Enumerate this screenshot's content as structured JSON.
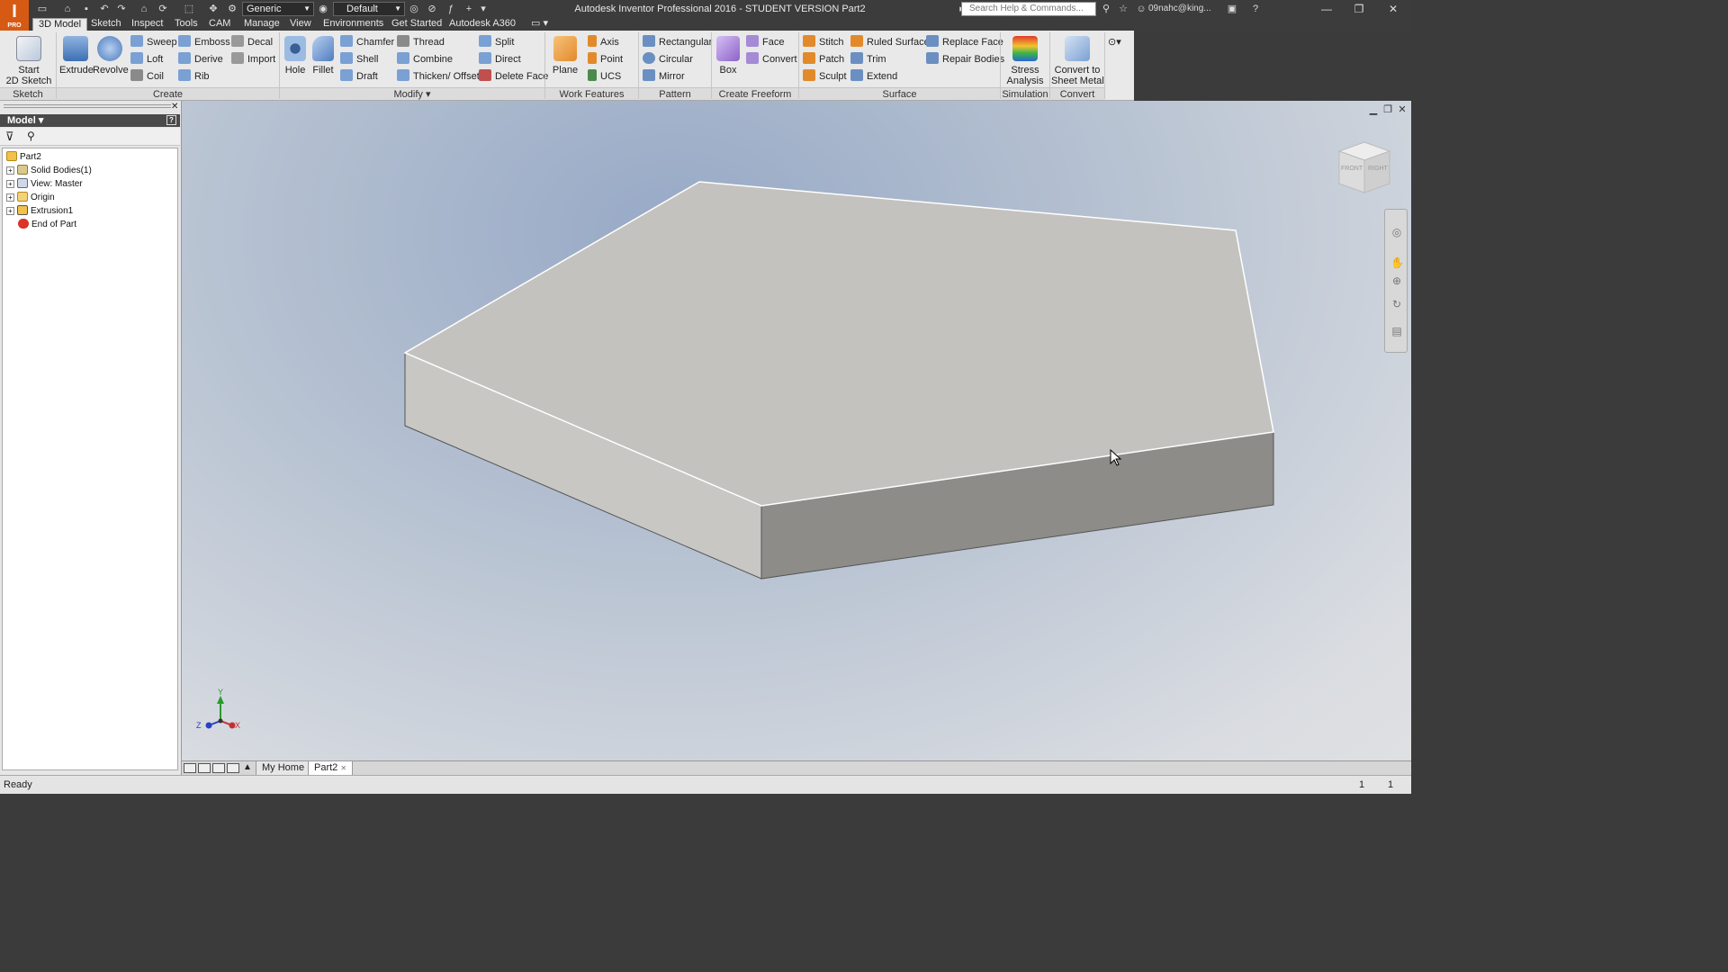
{
  "window": {
    "title": "Autodesk Inventor Professional 2016 - STUDENT VERSION   Part2",
    "logo_letter": "I",
    "logo_sub": "PRO"
  },
  "quick_access": {
    "material": "Generic",
    "appearance": "Default",
    "icons": [
      "new-icon",
      "open-icon",
      "save-icon",
      "undo-icon",
      "redo-icon",
      "home-icon",
      "select-icon",
      "measure-icon",
      "function-icon"
    ]
  },
  "search": {
    "placeholder": "Search Help & Commands..."
  },
  "user": {
    "name": "09nahc@king..."
  },
  "ribbon_tabs": [
    "3D Model",
    "Sketch",
    "Inspect",
    "Tools",
    "CAM",
    "Manage",
    "View",
    "Environments",
    "Get Started",
    "Autodesk A360"
  ],
  "panels": {
    "sketch": {
      "title": "Sketch",
      "start_sketch": "Start\n2D Sketch"
    },
    "create": {
      "title": "Create",
      "extrude": "Extrude",
      "revolve": "Revolve",
      "sweep": "Sweep",
      "loft": "Loft",
      "coil": "Coil",
      "emboss": "Emboss",
      "derive": "Derive",
      "rib": "Rib",
      "decal": "Decal",
      "import": "Import"
    },
    "modify": {
      "title": "Modify ▾",
      "hole": "Hole",
      "fillet": "Fillet",
      "chamfer": "Chamfer",
      "shell": "Shell",
      "draft": "Draft",
      "thread": "Thread",
      "combine": "Combine",
      "thicken": "Thicken/ Offset",
      "split": "Split",
      "direct": "Direct",
      "delete_face": "Delete Face"
    },
    "work_features": {
      "title": "Work Features",
      "plane": "Plane",
      "axis": "Axis",
      "point": "Point",
      "ucs": "UCS"
    },
    "pattern": {
      "title": "Pattern",
      "rectangular": "Rectangular",
      "circular": "Circular",
      "mirror": "Mirror"
    },
    "freeform": {
      "title": "Create Freeform",
      "box": "Box",
      "face": "Face",
      "convert": "Convert"
    },
    "surface": {
      "title": "Surface",
      "stitch": "Stitch",
      "patch": "Patch",
      "sculpt": "Sculpt",
      "ruled_surface": "Ruled Surface",
      "trim": "Trim",
      "extend": "Extend",
      "replace_face": "Replace Face",
      "repair_bodies": "Repair Bodies"
    },
    "simulation": {
      "title": "Simulation",
      "stress_analysis": "Stress\nAnalysis"
    },
    "convert": {
      "title": "Convert",
      "sheet_metal": "Convert to\nSheet Metal"
    }
  },
  "browser": {
    "header": "Model ▾",
    "tree": [
      {
        "label": "Part2",
        "icon": "part-icon"
      },
      {
        "label": "Solid Bodies(1)",
        "icon": "solid-bodies-icon"
      },
      {
        "label": "View: Master",
        "icon": "view-icon"
      },
      {
        "label": "Origin",
        "icon": "folder-icon"
      },
      {
        "label": "Extrusion1",
        "icon": "extrusion-icon"
      },
      {
        "label": "End of Part",
        "icon": "end-of-part-icon"
      }
    ]
  },
  "viewcube": {
    "front": "FRONT",
    "right": "RIGHT"
  },
  "triad": {
    "x": "X",
    "y": "Y",
    "z": "Z"
  },
  "doc_tabs": [
    "My Home",
    "Part2"
  ],
  "status": {
    "text": "Ready",
    "count1": "1",
    "count2": "1"
  },
  "colors": {
    "accent": "#d75a14",
    "part_top": "#c3c2bf",
    "part_front": "#8d8c89",
    "part_left": "#c8c7c4"
  }
}
